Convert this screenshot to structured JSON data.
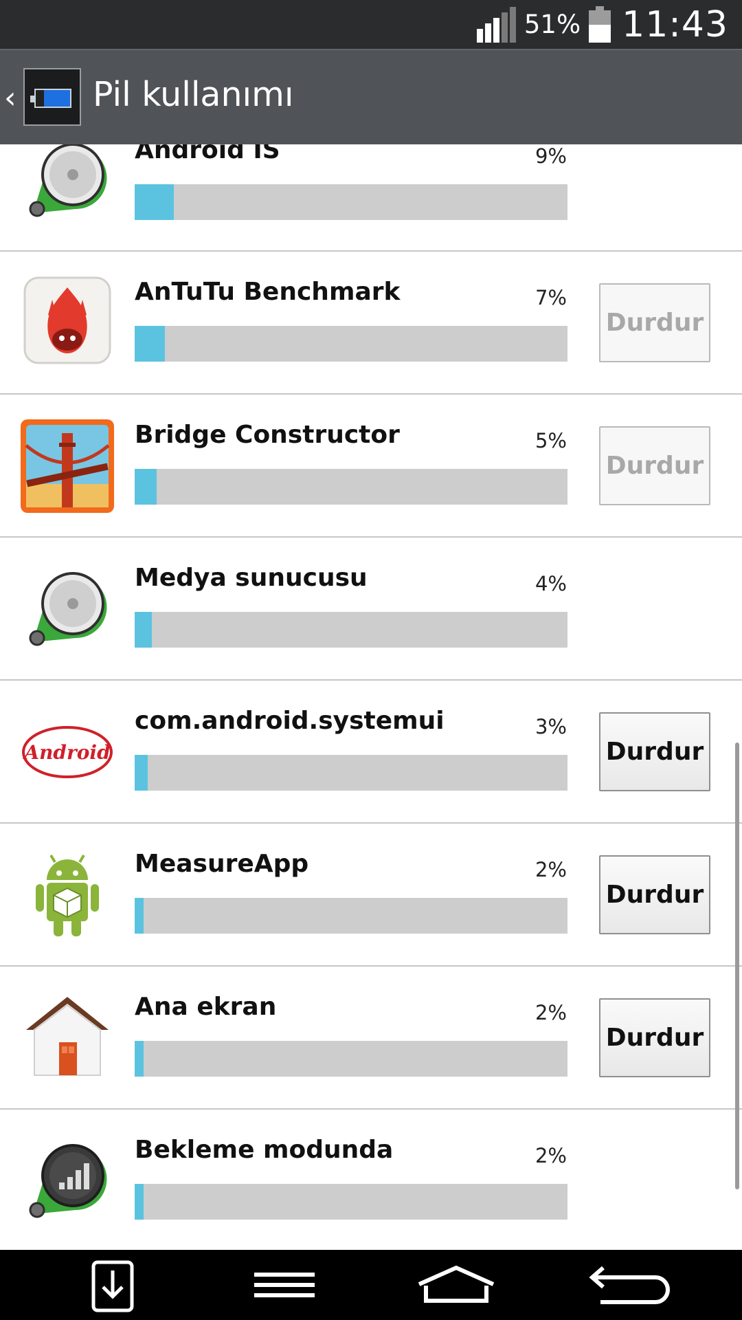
{
  "status": {
    "battery_percent": "51%",
    "time": "11:43",
    "signal_icon": "signal-bars-icon",
    "battery_icon": "battery-icon"
  },
  "header": {
    "title": "Pil kullanımı",
    "back_icon": "back-chevron-icon",
    "app_icon": "battery-app-icon"
  },
  "colors": {
    "bar_fill": "#5bc3e0",
    "bar_track": "#cdcdcd",
    "titlebar": "#505357",
    "statusbar": "#2b2c2e"
  },
  "items": [
    {
      "name": "Android İS",
      "percent": "9%",
      "level": 0.09,
      "icon": "android-os-icon",
      "stop": null
    },
    {
      "name": "AnTuTu Benchmark",
      "percent": "7%",
      "level": 0.07,
      "icon": "antutu-icon",
      "stop": {
        "label": "Durdur",
        "enabled": false
      }
    },
    {
      "name": "Bridge Constructor",
      "percent": "5%",
      "level": 0.05,
      "icon": "bridge-constructor-icon",
      "stop": {
        "label": "Durdur",
        "enabled": false
      }
    },
    {
      "name": "Medya sunucusu",
      "percent": "4%",
      "level": 0.04,
      "icon": "media-server-icon",
      "stop": null
    },
    {
      "name": "com.android.systemui",
      "percent": "3%",
      "level": 0.03,
      "icon": "android-logo-icon",
      "stop": {
        "label": "Durdur",
        "enabled": true
      }
    },
    {
      "name": "MeasureApp",
      "percent": "2%",
      "level": 0.02,
      "icon": "android-robot-icon",
      "stop": {
        "label": "Durdur",
        "enabled": true
      }
    },
    {
      "name": "Ana ekran",
      "percent": "2%",
      "level": 0.02,
      "icon": "home-icon",
      "stop": {
        "label": "Durdur",
        "enabled": true
      }
    },
    {
      "name": "Bekleme modunda",
      "percent": "2%",
      "level": 0.02,
      "icon": "standby-icon",
      "stop": null
    }
  ],
  "nav": {
    "icons": [
      "download-tray-icon",
      "menu-icon",
      "home-icon",
      "back-icon"
    ]
  }
}
